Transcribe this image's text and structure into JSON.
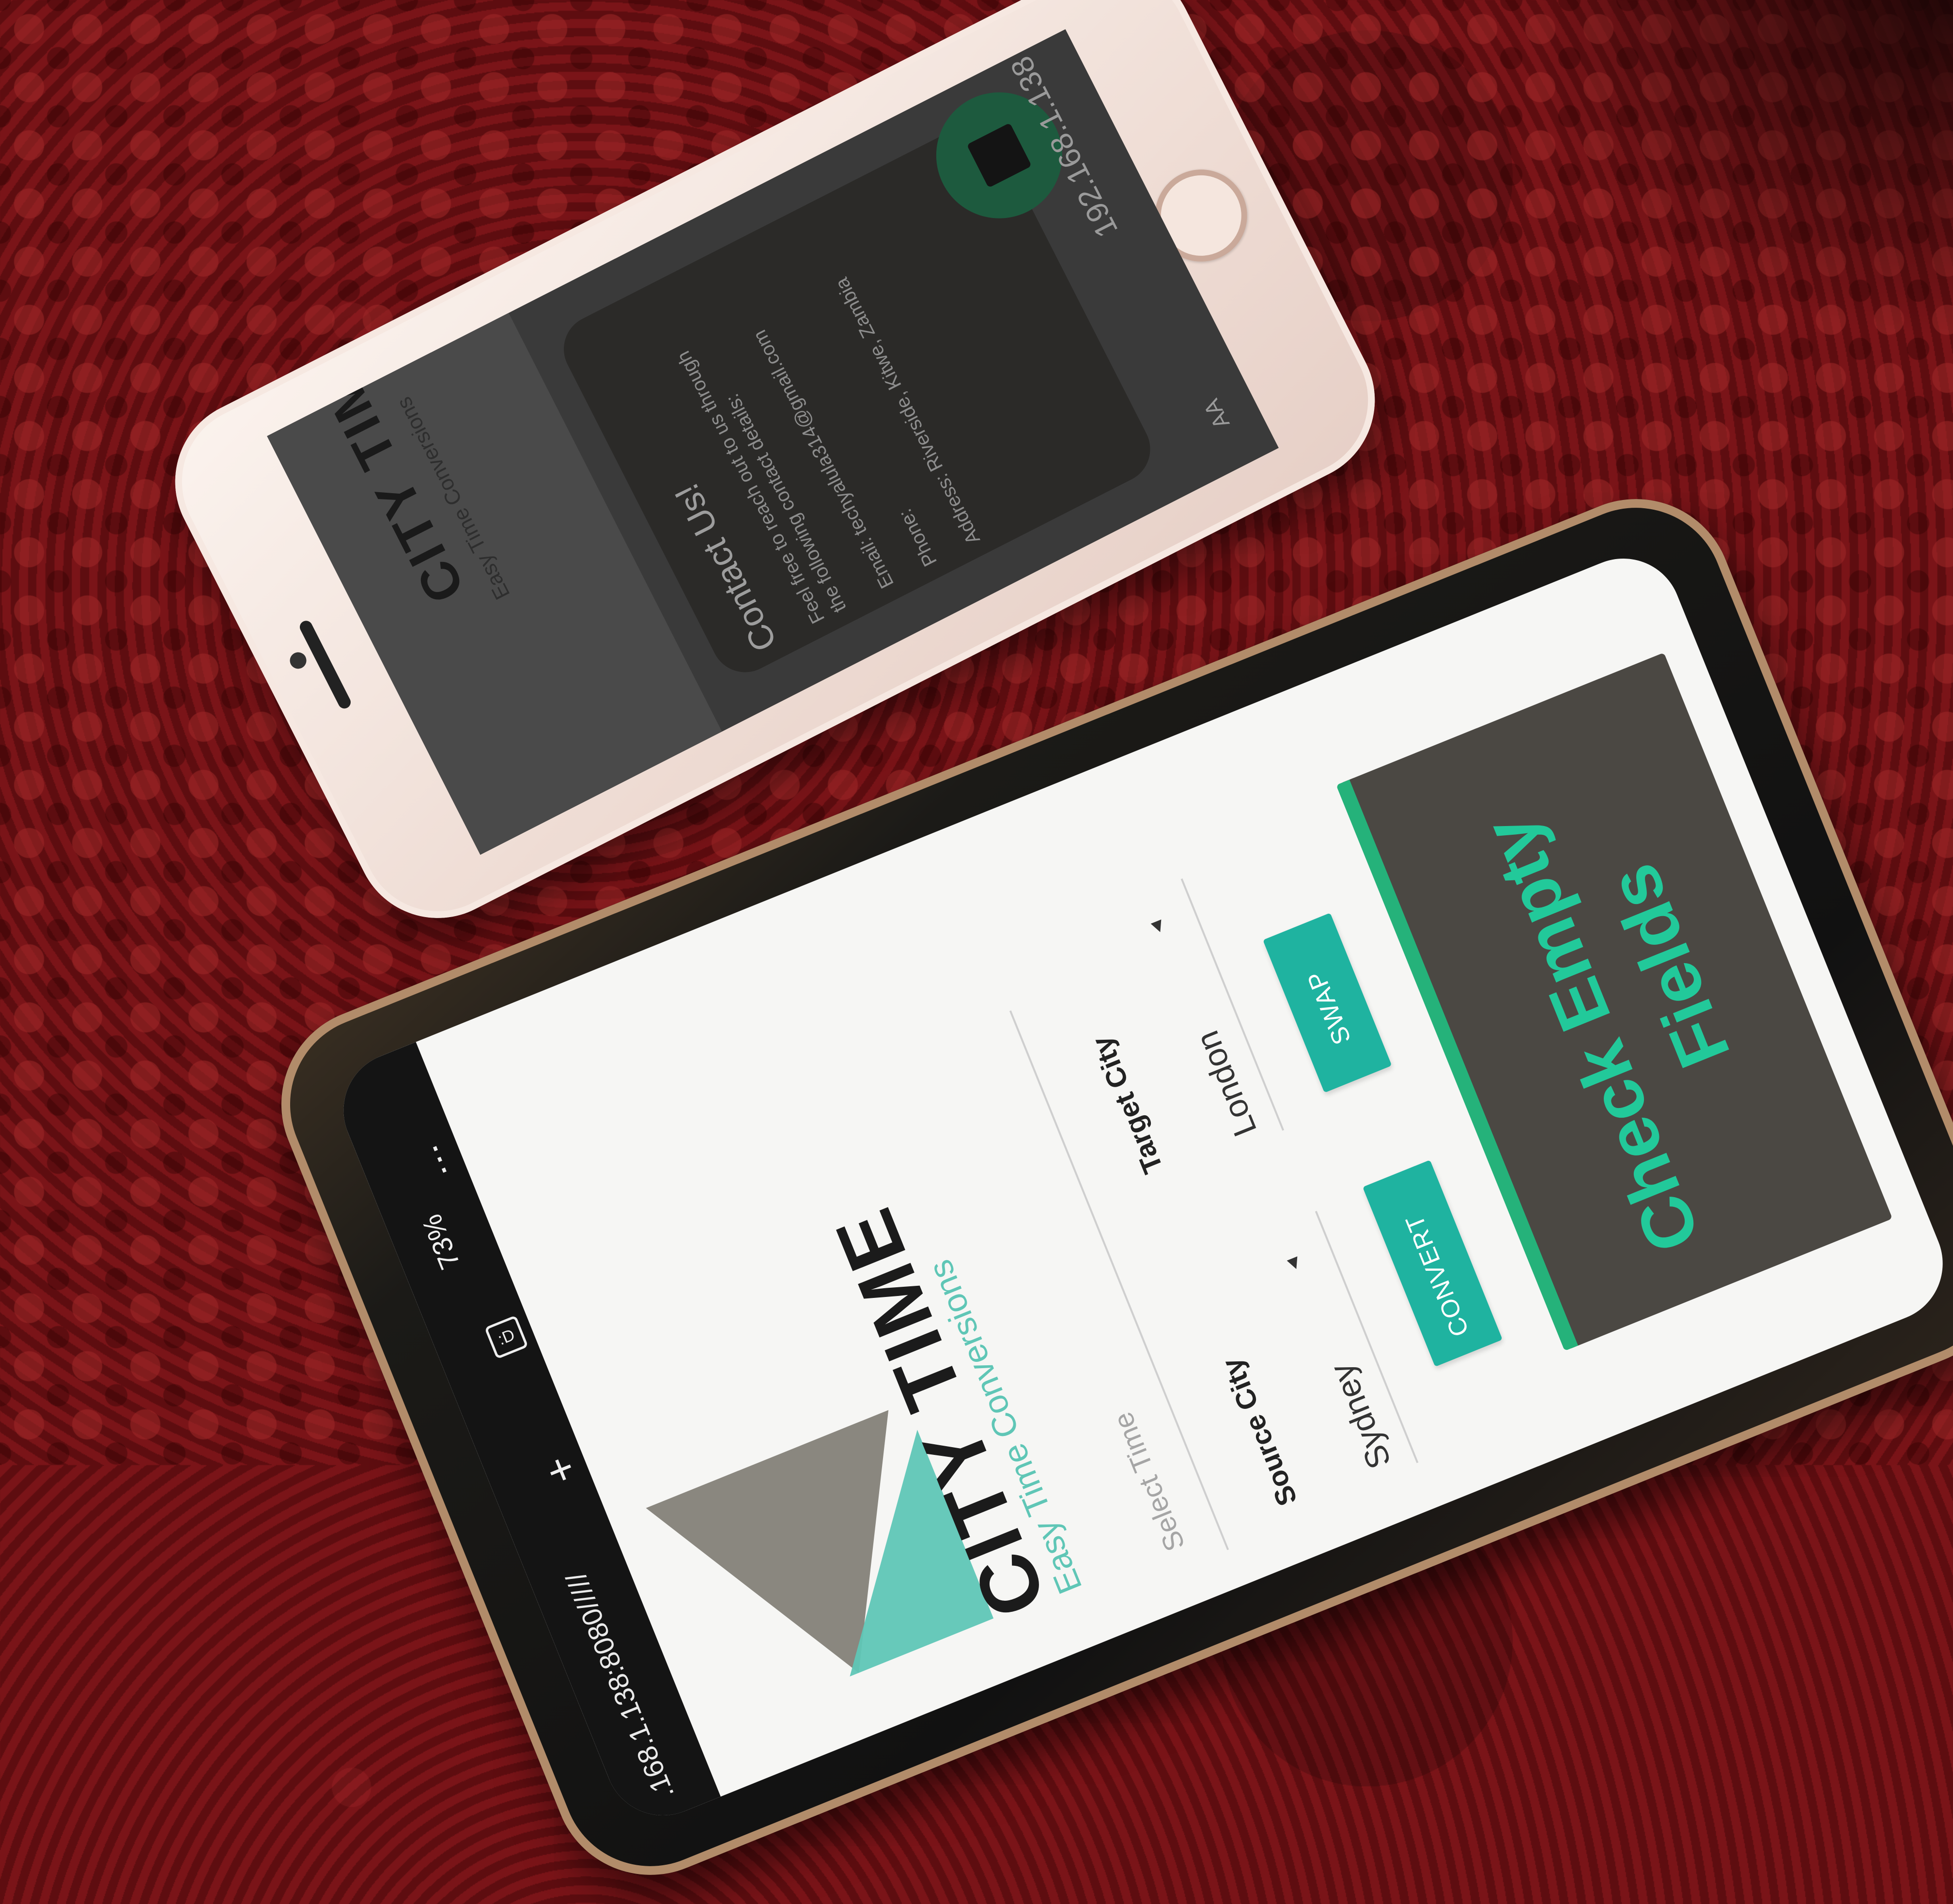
{
  "iphone": {
    "header": {
      "title": "CITY TIME",
      "subtitle": "Easy Time Conversions"
    },
    "dialog": {
      "heading": "Contact Us!",
      "intro_line1": "Feel free to reach out to us through",
      "intro_line2": "the following contact details:",
      "email": "Email: techyalula314@gmail.com",
      "phone": "Phone:",
      "address": "Address: Riverside, Kitwe, Zambia"
    },
    "url_bar": {
      "address": "192.168.1.138",
      "text_size_label": "AA"
    }
  },
  "android": {
    "status_bar": {
      "battery": "73%",
      "url": ".168.1.138:8080/////",
      "tab_count": ":D",
      "new_tab_label": "+",
      "menu_label": "⋮"
    },
    "header": {
      "title": "CITY TIME",
      "subtitle": "Easy Time Conversions"
    },
    "form": {
      "time_placeholder": "Select Time",
      "source_label": "Source City",
      "source_value": "Sydney",
      "target_label": "Target City",
      "target_value": "London",
      "convert_label": "CONVERT",
      "swap_label": "SWAP"
    },
    "toast": {
      "line1": "Check Empty",
      "line2": "Fields"
    },
    "colors": {
      "accent": "#1fb3a0",
      "toast_text": "#22c99a",
      "logo_teal": "#5fc6b6",
      "logo_gray": "#7d7a73"
    }
  }
}
